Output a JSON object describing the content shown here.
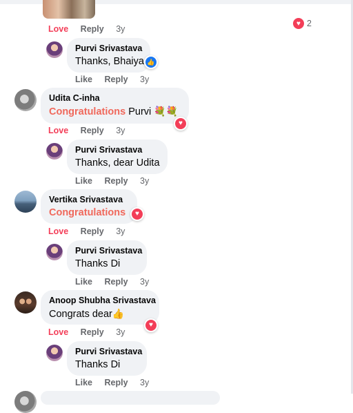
{
  "top": {
    "reactions_count": "2"
  },
  "actions": {
    "love": "Love",
    "like": "Like",
    "reply": "Reply",
    "time": "3y"
  },
  "comments": [
    {
      "name": "Purvi Srivastava",
      "text": "Thanks, Bhaiya"
    },
    {
      "name": "Udita C-inha",
      "text_highlight": "Congratulations",
      "text": "Purvi",
      "emoji": "💐💐"
    },
    {
      "name": "Purvi Srivastava",
      "text": "Thanks, dear Udita"
    },
    {
      "name": "Vertika Srivastava",
      "text_highlight": "Congratulations"
    },
    {
      "name": "Purvi Srivastava",
      "text": "Thanks Di"
    },
    {
      "name": "Anoop Shubha Srivastava",
      "text": "Congrats dear",
      "emoji": "👍"
    },
    {
      "name": "Purvi Srivastava",
      "text": "Thanks Di"
    }
  ],
  "icons": {
    "love": "heart-icon",
    "like": "thumbs-up-icon"
  },
  "colors": {
    "love": "#f33e58",
    "like": "#1877f2",
    "congrats": "#f0685b",
    "bubble": "#f0f2f5"
  }
}
